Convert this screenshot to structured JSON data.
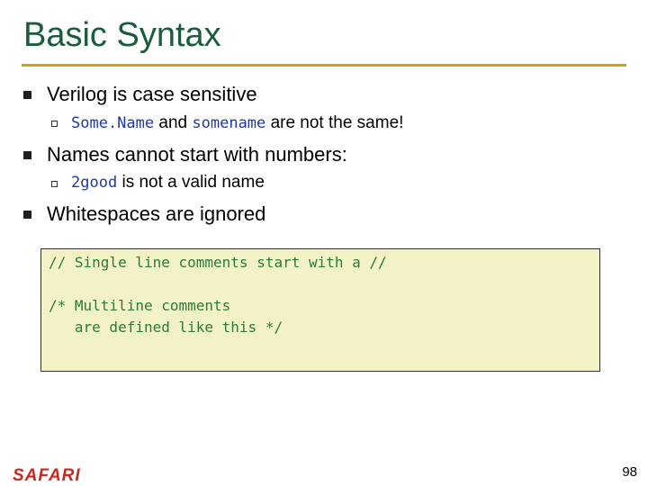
{
  "slide": {
    "title": "Basic Syntax",
    "bullets": [
      {
        "text": "Verilog is case sensitive",
        "sub": {
          "code1": "Some.Name",
          "mid": "and",
          "code2": "somename",
          "tail": "are not the same!"
        }
      },
      {
        "text": "Names cannot start with numbers:",
        "sub": {
          "code1": "2good",
          "tail": "is not a valid name"
        }
      },
      {
        "text": "Whitespaces are ignored"
      }
    ],
    "code_block": {
      "line1": "// Single line comments start with a //",
      "line2": "/* Multiline comments",
      "line3": "   are defined like this */"
    },
    "footer": {
      "logo": "SAFARI",
      "page_number": "98"
    }
  },
  "colors": {
    "title": "#1a5c3c",
    "rule": "#c9a227",
    "code_bg": "#f3f2c4",
    "code_text": "#2e7a3c",
    "inline_code": "#1f3aa8",
    "logo": "#c8281e"
  }
}
